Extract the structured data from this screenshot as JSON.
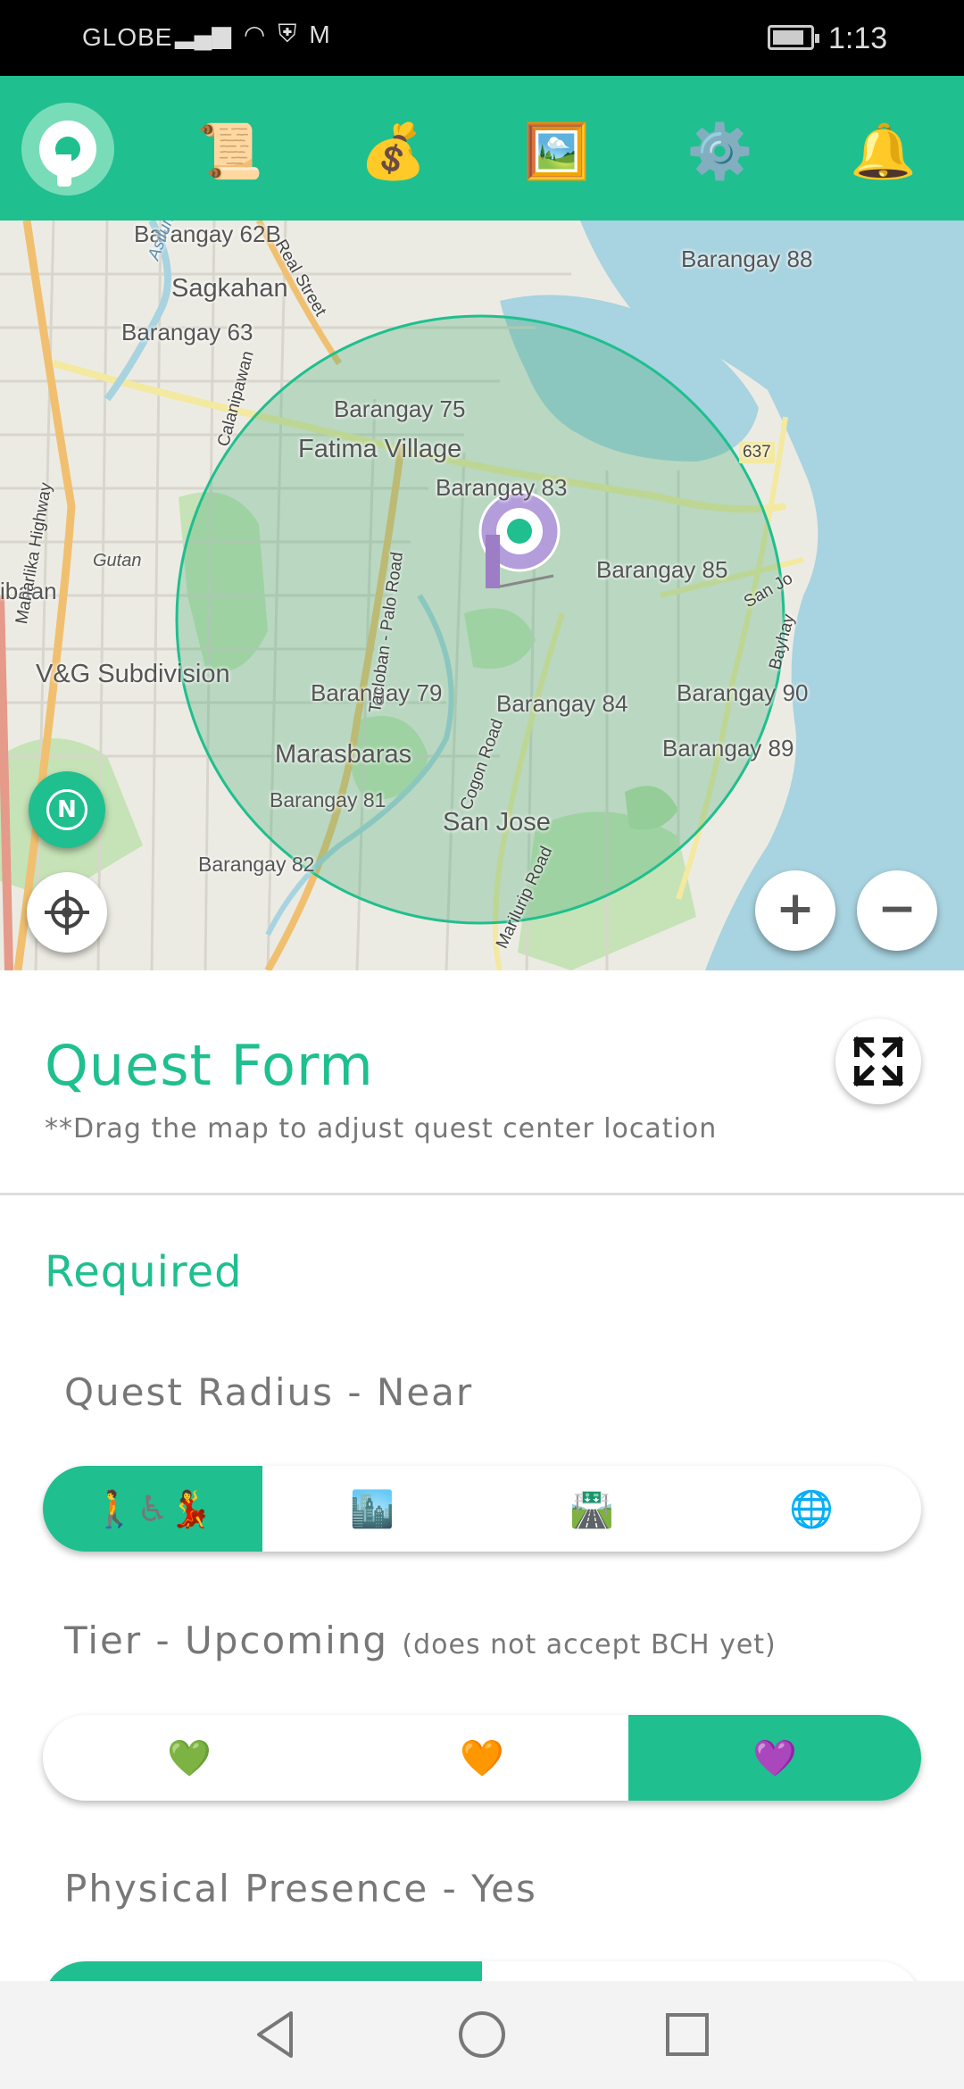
{
  "status_bar": {
    "carrier": "GLOBE",
    "time": "1:13",
    "icons": [
      "signal-icon",
      "wifi-icon",
      "shield-icon",
      "gmail-icon",
      "battery-icon"
    ]
  },
  "nav": {
    "items": [
      {
        "name": "quests-scroll-icon",
        "glyph": "📜"
      },
      {
        "name": "money-bag-icon",
        "glyph": "💰"
      },
      {
        "name": "gallery-picture-icon",
        "glyph": "🖼️"
      },
      {
        "name": "settings-gear-icon",
        "glyph": "⚙️"
      },
      {
        "name": "notifications-bell-icon",
        "glyph": "🔔"
      }
    ]
  },
  "map": {
    "labels": {
      "sagkahan": "Sagkahan",
      "b63": "Barangay 63",
      "b75": "Barangay 75",
      "fatima": "Fatima Village",
      "b83": "Barangay 83",
      "b85": "Barangay 85",
      "b88": "Barangay 88",
      "b79": "Barangay 79",
      "b84": "Barangay 84",
      "b90": "Barangay 90",
      "b89": "Barangay 89",
      "marasbaras": "Marasbaras",
      "b81": "Barangay 81",
      "b82": "Barangay 82",
      "sanjose": "San Jose",
      "vg": "V&G Subdivision",
      "gutan": "Gutan",
      "ibaan": "ibaan",
      "asilum": "Asilum",
      "realstreet": "Real Street",
      "maharlika": "Maharlika Highway",
      "calanipawan": "Calanipawan",
      "palo": "Tacloban - Palo Road",
      "cogon": "Cogon Road",
      "marilurip": "Marilurip Road",
      "sanjo": "San Jo",
      "bayhay": "Bayhay",
      "r637": "637",
      "b62b": "Barangay 62B"
    },
    "compass_label": "N",
    "zoom_in": "+",
    "zoom_out": "−"
  },
  "form": {
    "title": "Quest Form",
    "hint": "**Drag the map to adjust quest center location",
    "section_required": "Required",
    "quest_radius": {
      "label": "Quest Radius - Near",
      "options": [
        {
          "name": "radius-near-option",
          "glyph": "🚶♿💃",
          "active": true
        },
        {
          "name": "radius-city-option",
          "glyph": "🏙️",
          "active": false
        },
        {
          "name": "radius-highway-option",
          "glyph": "🛣️",
          "active": false
        },
        {
          "name": "radius-global-option",
          "glyph": "🌐",
          "active": false
        }
      ]
    },
    "tier": {
      "label": "Tier - Upcoming",
      "note": "(does not accept BCH yet)",
      "options": [
        {
          "name": "tier-green-option",
          "glyph": "💚",
          "active": false
        },
        {
          "name": "tier-orange-option",
          "glyph": "🧡",
          "active": false
        },
        {
          "name": "tier-purple-option",
          "glyph": "💜",
          "active": true
        }
      ]
    },
    "physical_presence": {
      "label": "Physical Presence - Yes"
    }
  },
  "colors": {
    "accent": "#1fbf8f",
    "map_water": "#a8d3e0",
    "radius_fill": "#4fae7a"
  }
}
